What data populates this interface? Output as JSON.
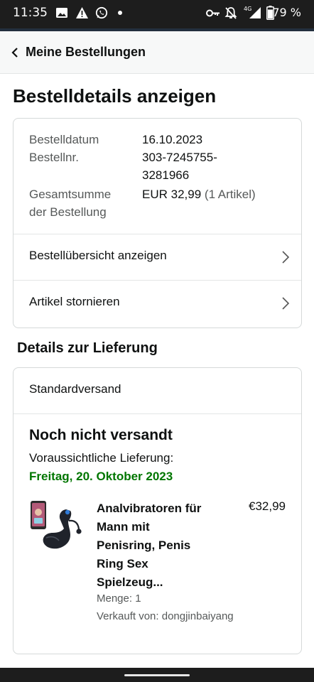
{
  "status_bar": {
    "time": "11:35",
    "battery": "79 %",
    "network": "4G",
    "left_icons": [
      "image-icon",
      "warning-icon",
      "whatsapp-icon",
      "dot-icon"
    ],
    "right_icons": [
      "vpn-key-icon",
      "bell-muted-icon",
      "signal-icon",
      "battery-icon"
    ]
  },
  "header": {
    "back_label": "Meine Bestellungen"
  },
  "page_title": "Bestelldetails anzeigen",
  "order": {
    "date_label": "Bestelldatum",
    "date_value": "16.10.2023",
    "number_label": "Bestellnr.",
    "number_line1": "303-7245755-",
    "number_line2": "3281966",
    "total_label_line1": "Gesamtsumme",
    "total_label_line2": "der Bestellung",
    "total_value": "EUR 32,99",
    "total_items": "(1 Artikel)"
  },
  "actions": [
    {
      "label": "Bestellübersicht anzeigen"
    },
    {
      "label": "Artikel stornieren"
    }
  ],
  "delivery": {
    "section_title": "Details zur Lieferung",
    "method": "Standardversand",
    "status": "Noch nicht versandt",
    "eta_label": "Voraussichtliche Lieferung:",
    "eta_date": "Freitag, 20. Oktober 2023",
    "eta_color": "#007600"
  },
  "item": {
    "title_lines": [
      "Analvibratoren für",
      "Mann mit",
      "Penisring, Penis",
      "Ring Sex",
      "Spielzeug..."
    ],
    "price": "€32,99",
    "quantity": "Menge: 1",
    "seller": "Verkauft von: dongjinbaiyang"
  },
  "colors": {
    "status_bar_bg": "#1d1d1d",
    "header_bg": "#f7f8f8",
    "accent_green": "#007600",
    "text_primary": "#0f1111",
    "text_secondary": "#565959"
  }
}
